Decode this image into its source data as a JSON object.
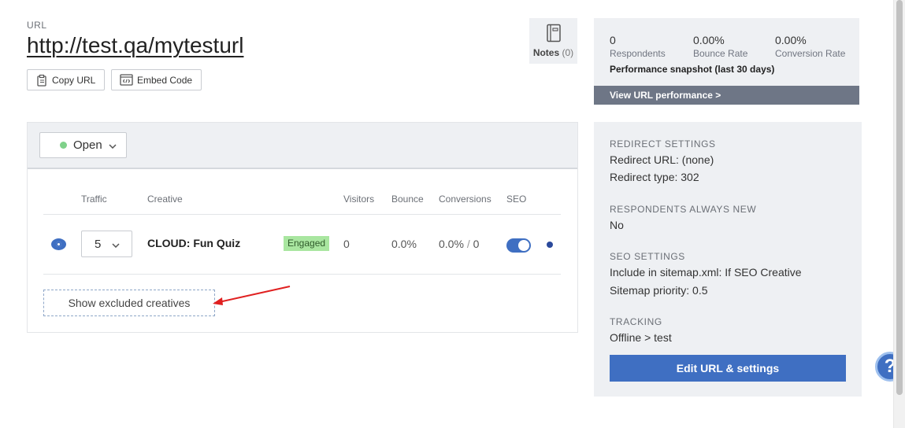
{
  "header": {
    "url_label": "URL",
    "url": "http://test.qa/mytesturl",
    "copy_url": "Copy URL",
    "embed_code": "Embed Code"
  },
  "notes": {
    "label": "Notes",
    "count": "(0)"
  },
  "performance": {
    "respondents_value": "0",
    "respondents_label": "Respondents",
    "bounce_value": "0.00%",
    "bounce_label": "Bounce Rate",
    "conversion_value": "0.00%",
    "conversion_label": "Conversion Rate",
    "snapshot": "Performance snapshot (last 30 days)",
    "link": "View URL performance >"
  },
  "status": {
    "label": "Open",
    "color": "#7fd18a"
  },
  "table": {
    "headers": {
      "traffic": "Traffic",
      "creative": "Creative",
      "visitors": "Visitors",
      "bounce": "Bounce",
      "conversions": "Conversions",
      "seo": "SEO"
    },
    "rows": [
      {
        "traffic": "5",
        "creative": "CLOUD: Fun Quiz",
        "badge": "Engaged",
        "visitors": "0",
        "bounce": "0.0%",
        "conversions_rate": "0.0%",
        "conversions_sep": "/",
        "conversions_count": "0",
        "seo_enabled": true
      }
    ]
  },
  "show_excluded": "Show excluded creatives",
  "settings": {
    "redirect_title": "REDIRECT SETTINGS",
    "redirect_url": "Redirect URL: (none)",
    "redirect_type": "Redirect type: 302",
    "respondents_title": "RESPONDENTS ALWAYS NEW",
    "respondents_value": "No",
    "seo_title": "SEO SETTINGS",
    "seo_sitemap": "Include in sitemap.xml: If SEO Creative",
    "seo_priority": "Sitemap priority: 0.5",
    "tracking_title": "TRACKING",
    "tracking_value": "Offline > test",
    "edit_button": "Edit URL & settings"
  },
  "help": "?",
  "colors": {
    "accent": "#3f6fc2",
    "panel": "#eef0f3",
    "badge": "#a9e6a0",
    "perf_link": "#6e7686"
  }
}
